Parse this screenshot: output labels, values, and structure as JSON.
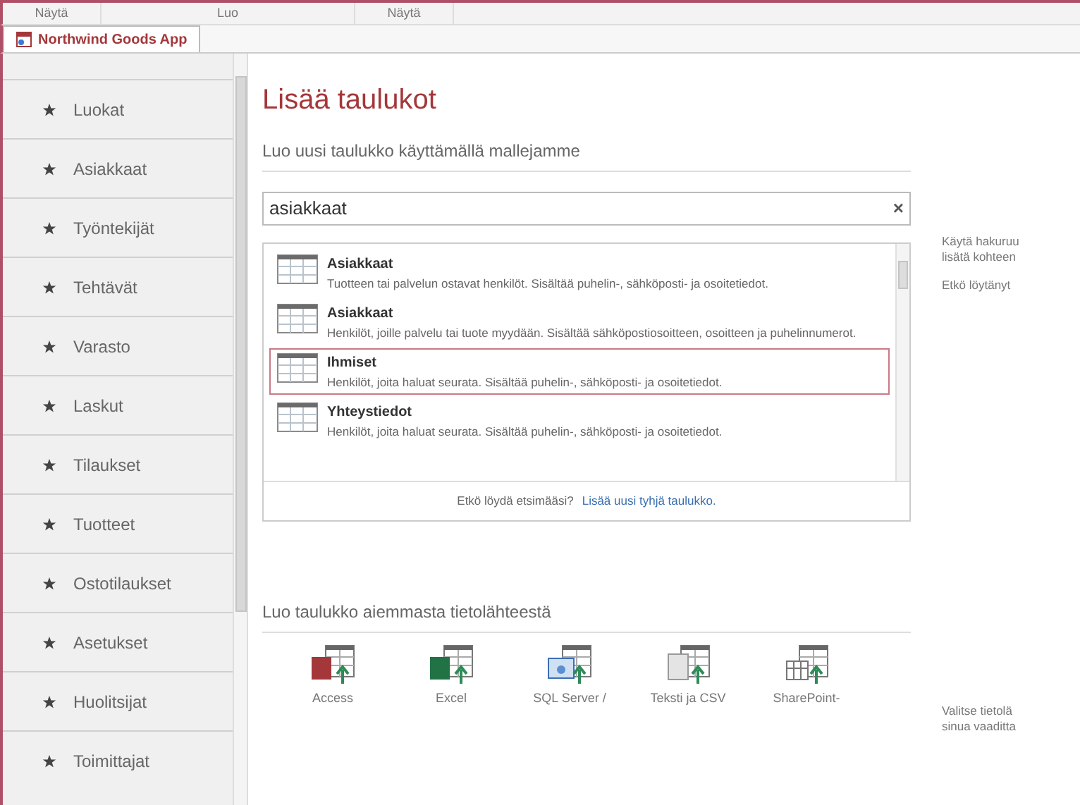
{
  "ribbon_groups": [
    "Näytä",
    "Luo",
    "Näytä"
  ],
  "app_tab": {
    "label": "Northwind Goods App",
    "selected": true
  },
  "sidebar": {
    "items": [
      {
        "label": "Luokat"
      },
      {
        "label": "Asiakkaat"
      },
      {
        "label": "Työntekijät"
      },
      {
        "label": "Tehtävät"
      },
      {
        "label": "Varasto"
      },
      {
        "label": "Laskut"
      },
      {
        "label": "Tilaukset"
      },
      {
        "label": "Tuotteet"
      },
      {
        "label": "Ostotilaukset"
      },
      {
        "label": "Asetukset"
      },
      {
        "label": "Huolitsijat"
      },
      {
        "label": "Toimittajat"
      }
    ]
  },
  "title": "Lisää taulukot",
  "template_section": {
    "heading": "Luo uusi taulukko käyttämällä mallejamme",
    "search": {
      "value": "asiakkaat",
      "clear": "×"
    },
    "results": [
      {
        "name": "Asiakkaat",
        "description": "Tuotteen tai palvelun ostavat henkilöt. Sisältää puhelin-, sähköposti- ja osoitetiedot.",
        "selected": false
      },
      {
        "name": "Asiakkaat",
        "description": "Henkilöt, joille palvelu tai tuote myydään. Sisältää sähköpostiosoitteen, osoitteen ja puhelinnumerot.",
        "selected": false
      },
      {
        "name": "Ihmiset",
        "description": "Henkilöt, joita haluat seurata. Sisältää puhelin-, sähköposti- ja osoitetiedot.",
        "selected": true
      },
      {
        "name": "Yhteystiedot",
        "description": "Henkilöt, joita haluat seurata. Sisältää puhelin-, sähköposti- ja osoitetiedot.",
        "selected": false
      }
    ],
    "footer_text": "Etkö löydä etsimääsi?",
    "footer_link": "Lisää uusi tyhjä taulukko.",
    "side_help": [
      "Käytä hakuruu",
      "lisätä kohteen",
      "Etkö löytänyt"
    ]
  },
  "source_section": {
    "heading": "Luo taulukko aiemmasta tietolähteestä",
    "sources": [
      {
        "kind": "access",
        "label": "Access"
      },
      {
        "kind": "excel",
        "label": "Excel"
      },
      {
        "kind": "sql",
        "label": "SQL Server /"
      },
      {
        "kind": "text",
        "label": "Teksti ja CSV"
      },
      {
        "kind": "sharepoint",
        "label": "SharePoint-"
      }
    ],
    "side_help": [
      "Valitse tietolä",
      "sinua vaaditta"
    ]
  }
}
